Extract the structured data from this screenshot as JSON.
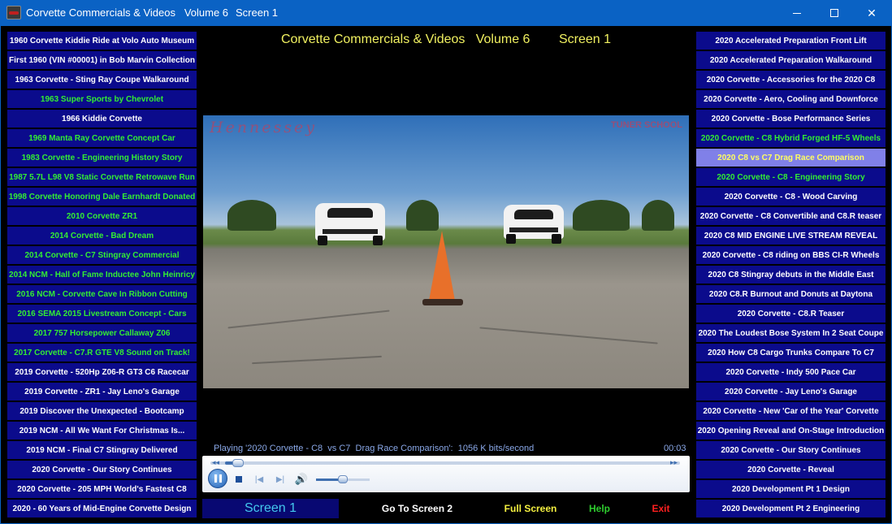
{
  "window": {
    "title": "Corvette Commercials & Videos   Volume 6",
    "screen_label": "Screen 1"
  },
  "heading": "Corvette Commercials & Videos   Volume 6        Screen 1",
  "left_list": [
    {
      "label": "1960 Corvette Kiddie Ride at Volo Auto Museum",
      "style": "white"
    },
    {
      "label": "First 1960 (VIN #00001) in Bob Marvin Collection",
      "style": "white"
    },
    {
      "label": "1963 Corvette - Sting Ray Coupe Walkaround",
      "style": "white"
    },
    {
      "label": "1963 Super Sports by Chevrolet",
      "style": "green"
    },
    {
      "label": "1966 Kiddie Corvette",
      "style": "white"
    },
    {
      "label": "1969 Manta Ray Corvette Concept Car",
      "style": "green"
    },
    {
      "label": "1983 Corvette - Engineering History Story",
      "style": "green"
    },
    {
      "label": "1987 5.7L L98 V8 Static Corvette Retrowave Run",
      "style": "green"
    },
    {
      "label": "1998 Corvette Honoring Dale Earnhardt Donated",
      "style": "green"
    },
    {
      "label": "2010 Corvette ZR1",
      "style": "green"
    },
    {
      "label": "2014 Corvette - Bad Dream",
      "style": "green"
    },
    {
      "label": "2014 Corvette - C7 Stingray Commercial",
      "style": "green"
    },
    {
      "label": "2014 NCM - Hall of Fame Inductee John Heinricy",
      "style": "green"
    },
    {
      "label": "2016 NCM - Corvette Cave In Ribbon Cutting",
      "style": "green"
    },
    {
      "label": "2016  SEMA 2015 Livestream Concept - Cars",
      "style": "green"
    },
    {
      "label": "2017 757 Horsepower Callaway  Z06",
      "style": "green"
    },
    {
      "label": "2017 Corvette - C7.R GTE V8 Sound on Track!",
      "style": "green"
    },
    {
      "label": "2019 Corvette - 520Hp Z06-R GT3 C6 Racecar",
      "style": "white"
    },
    {
      "label": "2019 Corvette - ZR1 - Jay Leno's Garage",
      "style": "white"
    },
    {
      "label": "2019 Discover the Unexpected - Bootcamp",
      "style": "white"
    },
    {
      "label": "2019 NCM - All We Want For Christmas Is...",
      "style": "white"
    },
    {
      "label": "2019 NCM - Final C7 Stingray Delivered",
      "style": "white"
    },
    {
      "label": "2020 Corvette  -  Our Story Continues",
      "style": "white"
    },
    {
      "label": "2020 Corvette - 205 MPH  World's Fastest C8",
      "style": "white"
    },
    {
      "label": "2020 - 60 Years of Mid-Engine Corvette Design",
      "style": "white"
    }
  ],
  "right_list": [
    {
      "label": "2020 Accelerated Preparation  Front Lift",
      "style": "white"
    },
    {
      "label": "2020 Accelerated Preparation  Walkaround",
      "style": "white"
    },
    {
      "label": "2020 Corvette - Accessories for the 2020 C8",
      "style": "white"
    },
    {
      "label": "2020 Corvette - Aero, Cooling and Downforce",
      "style": "white"
    },
    {
      "label": "2020 Corvette - Bose Performance Series",
      "style": "white"
    },
    {
      "label": "2020 Corvette - C8   Hybrid Forged HF-5 Wheels",
      "style": "green"
    },
    {
      "label": "2020 C8  vs C7  Drag Race Comparison",
      "style": "selected"
    },
    {
      "label": "2020 Corvette - C8 - Engineering Story",
      "style": "green"
    },
    {
      "label": "2020 Corvette - C8 - Wood Carving",
      "style": "white"
    },
    {
      "label": "2020 Corvette - C8 Convertible and C8.R teaser",
      "style": "white"
    },
    {
      "label": "2020 C8 MID ENGINE LIVE STREAM REVEAL",
      "style": "white"
    },
    {
      "label": "2020 Corvette - C8 riding on BBS CI-R Wheels",
      "style": "white"
    },
    {
      "label": "2020 C8 Stingray debuts in the Middle East",
      "style": "white"
    },
    {
      "label": "2020 C8.R Burnout and Donuts at Daytona",
      "style": "white"
    },
    {
      "label": "2020 Corvette - C8.R Teaser",
      "style": "white"
    },
    {
      "label": "2020 The Loudest Bose System In 2 Seat Coupe",
      "style": "white"
    },
    {
      "label": "2020  How C8 Cargo Trunks Compare To C7",
      "style": "white"
    },
    {
      "label": "2020 Corvette - Indy 500 Pace Car",
      "style": "white"
    },
    {
      "label": "2020 Corvette - Jay Leno's Garage",
      "style": "white"
    },
    {
      "label": "2020 Corvette - New 'Car of the Year' Corvette",
      "style": "white"
    },
    {
      "label": "2020 Opening Reveal and On-Stage Introduction",
      "style": "white"
    },
    {
      "label": "2020 Corvette - Our Story Continues",
      "style": "white"
    },
    {
      "label": "2020 Corvette - Reveal",
      "style": "white"
    },
    {
      "label": "2020 Development Pt 1  Design",
      "style": "white"
    },
    {
      "label": "2020 Development Pt 2  Engineering",
      "style": "white"
    }
  ],
  "video": {
    "overlay_left": "Hennessey",
    "overlay_right": "TUNER SCHOOL"
  },
  "player": {
    "status": "Playing '2020 Corvette - C8  vs C7  Drag Race Comparison':  1056 K bits/second",
    "time": "00:03",
    "seek_fraction": 0.03,
    "volume_fraction": 0.5
  },
  "buttons": {
    "screen1": "Screen 1",
    "screen2": "Go To Screen 2",
    "full": "Full Screen",
    "help": "Help",
    "exit": "Exit"
  },
  "icons": {
    "minimize": "minimize-icon",
    "maximize": "maximize-icon",
    "close": "close-icon",
    "pause": "pause-icon",
    "stop": "stop-icon",
    "prev": "previous-icon",
    "next": "next-icon",
    "speaker": "speaker-icon"
  }
}
